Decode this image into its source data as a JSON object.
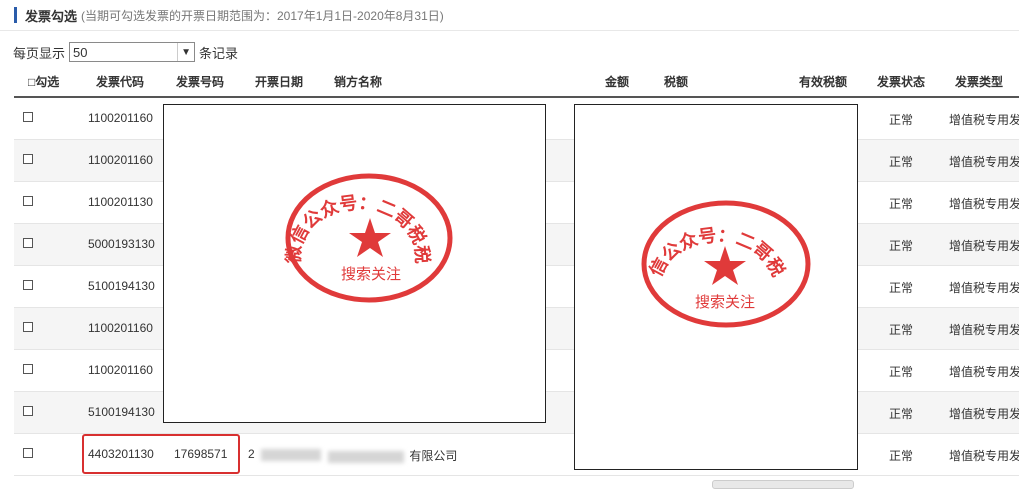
{
  "header": {
    "title": "发票勾选",
    "note": "(当期可勾选发票的开票日期范围为：2017年1月1日-2020年8月31日)"
  },
  "pagination": {
    "prefix": "每页显示",
    "value": "50",
    "suffix": "条记录"
  },
  "columns": {
    "select": "□勾选",
    "code": "发票代码",
    "number": "发票号码",
    "date": "开票日期",
    "seller": "销方名称",
    "amount": "金额",
    "tax": "税额",
    "valid_tax": "有效税额",
    "status": "发票状态",
    "type": "发票类型"
  },
  "rows": [
    {
      "code": "1100201160",
      "status": "正常",
      "type": "增值税专用发票"
    },
    {
      "code": "1100201160",
      "status": "正常",
      "type": "增值税专用发票"
    },
    {
      "code": "1100201130",
      "status": "正常",
      "type": "增值税专用发票"
    },
    {
      "code": "5000193130",
      "status": "正常",
      "type": "增值税专用发票"
    },
    {
      "code": "5100194130",
      "status": "正常",
      "type": "增值税专用发票"
    },
    {
      "code": "1100201160",
      "status": "正常",
      "type": "增值税专用发票"
    },
    {
      "code": "1100201160",
      "status": "正常",
      "type": "增值税专用发票"
    },
    {
      "code": "5100194130",
      "status": "正常",
      "type": "增值税专用发票"
    },
    {
      "code": "4403201130",
      "number": "17698571",
      "date_prefix": "2",
      "seller_suffix": "有限公司",
      "status": "正常",
      "type": "增值税专用发票"
    }
  ],
  "stamp": {
    "arc_text": "微信公众号：二哥税税",
    "bottom_text": "搜索关注",
    "color": "#e03a3a"
  }
}
